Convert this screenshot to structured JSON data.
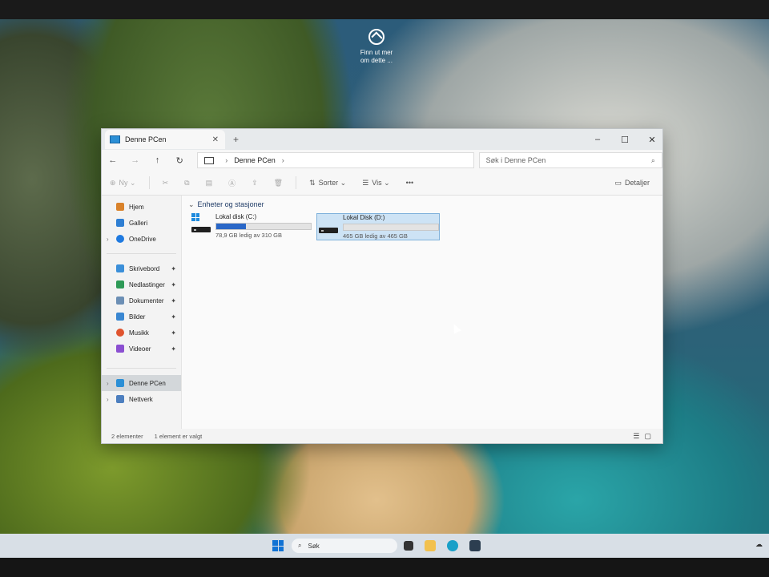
{
  "desktop": {
    "spotlight": {
      "line1": "Finn ut mer",
      "line2": "om dette ..."
    }
  },
  "window": {
    "tab_title": "Denne PCen",
    "new_tab": "+",
    "controls": {
      "minimize": "–",
      "maximize": "☐",
      "close": "✕"
    },
    "address": {
      "location": "Denne PCen"
    },
    "search": {
      "placeholder": "Søk i Denne PCen"
    },
    "toolbar": {
      "new": "Ny",
      "sort": "Sorter",
      "view": "Vis",
      "more": "•••",
      "details": "Detaljer"
    },
    "sidebar": {
      "top": [
        {
          "label": "Hjem",
          "icon": "home-icon",
          "color": "#d9822b"
        },
        {
          "label": "Galleri",
          "icon": "gallery-icon",
          "color": "#2f7fd3"
        },
        {
          "label": "OneDrive",
          "icon": "cloud-icon",
          "color": "#1f7ae0"
        }
      ],
      "quick": [
        {
          "label": "Skrivebord",
          "icon": "desktop-icon",
          "color": "#3b8fd9"
        },
        {
          "label": "Nedlastinger",
          "icon": "download-icon",
          "color": "#2e9a57"
        },
        {
          "label": "Dokumenter",
          "icon": "documents-icon",
          "color": "#6c8fb5"
        },
        {
          "label": "Bilder",
          "icon": "pictures-icon",
          "color": "#3a87d2"
        },
        {
          "label": "Musikk",
          "icon": "music-icon",
          "color": "#e0542f"
        },
        {
          "label": "Videoer",
          "icon": "videos-icon",
          "color": "#8b4fd1"
        }
      ],
      "bottom": [
        {
          "label": "Denne PCen",
          "icon": "pc-icon",
          "color": "#2b8fd6"
        },
        {
          "label": "Nettverk",
          "icon": "network-icon",
          "color": "#4d7fbf"
        }
      ]
    },
    "group_title": "Enheter og stasjoner",
    "drives": [
      {
        "name": "Lokal disk (C:)",
        "free_text": "78,9 GB ledig av 310 GB",
        "used_fraction": 0.31
      },
      {
        "name": "Lokal Disk (D:)",
        "free_text": "465 GB ledig av 465 GB",
        "used_fraction": 0.0
      }
    ],
    "status": {
      "count": "2 elementer",
      "selected": "1 element er valgt"
    }
  },
  "taskbar": {
    "search_label": "Søk"
  }
}
